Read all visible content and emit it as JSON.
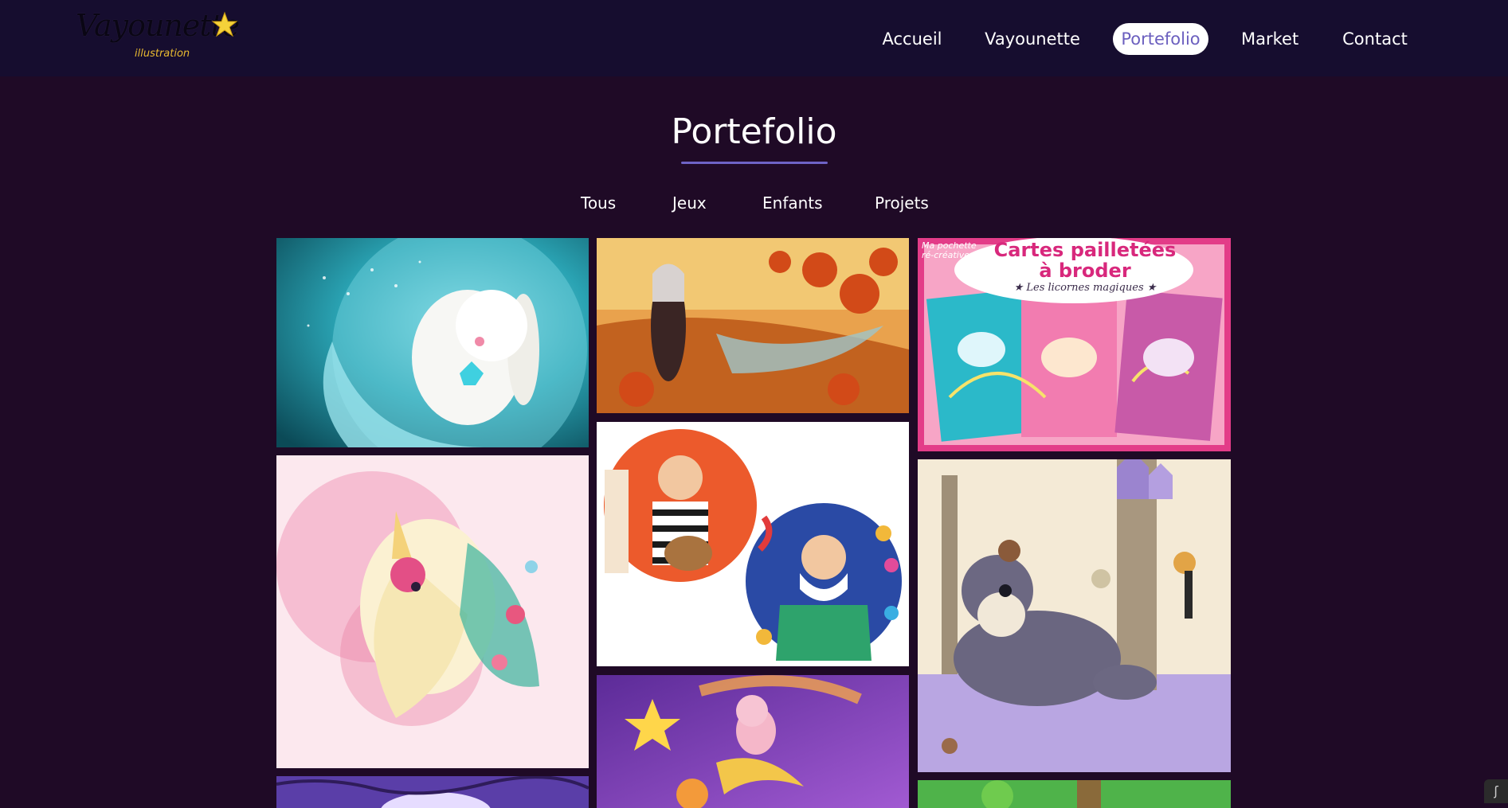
{
  "brand": {
    "logo_text": "Vayounette",
    "logo_sub": "illustration"
  },
  "nav": {
    "items": [
      {
        "label": "Accueil"
      },
      {
        "label": "Vayounette"
      },
      {
        "label": "Portefolio",
        "active": true
      },
      {
        "label": "Market"
      },
      {
        "label": "Contact"
      }
    ]
  },
  "page": {
    "title": "Portefolio"
  },
  "filters": [
    {
      "label": "Tous"
    },
    {
      "label": "Jeux"
    },
    {
      "label": "Enfants"
    },
    {
      "label": "Projets"
    }
  ],
  "gallery": {
    "cards_title": "Cartes pailletées",
    "cards_title2": "à broder",
    "cards_sub": "★ Les licornes magiques ★",
    "cards_tag1": "Ma pochette",
    "cards_tag2": "ré-créative"
  },
  "colors": {
    "header_bg": "#160d2f",
    "page_bg": "#1f0a26",
    "accent": "#6e63c6"
  }
}
